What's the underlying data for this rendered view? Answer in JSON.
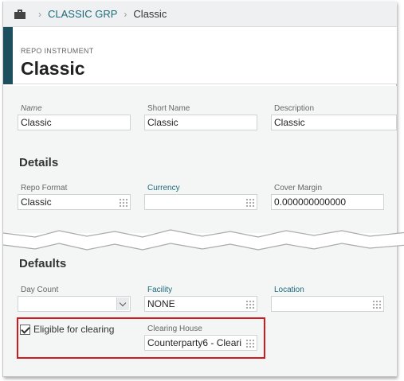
{
  "breadcrumb": {
    "home_icon": "briefcase-icon",
    "separator": "›",
    "group": "CLASSIC GRP",
    "current": "Classic"
  },
  "header": {
    "label": "REPO INSTRUMENT",
    "title": "Classic"
  },
  "general": {
    "name": {
      "label": "Name",
      "value": "Classic"
    },
    "short_name": {
      "label": "Short Name",
      "value": "Classic"
    },
    "description": {
      "label": "Description",
      "value": "Classic"
    }
  },
  "details": {
    "title": "Details",
    "repo_format": {
      "label": "Repo Format",
      "value": "Classic"
    },
    "currency": {
      "label": "Currency",
      "value": ""
    },
    "cover_margin": {
      "label": "Cover Margin",
      "value": "0.000000000000"
    }
  },
  "defaults": {
    "title": "Defaults",
    "day_count": {
      "label": "Day Count",
      "value": ""
    },
    "facility": {
      "label": "Facility",
      "value": "NONE"
    },
    "location": {
      "label": "Location",
      "value": ""
    },
    "eligible_for_clearing": {
      "label": "Eligible for clearing",
      "checked": true
    },
    "clearing_house": {
      "label": "Clearing House",
      "value": "Counterparty6 - Cleari"
    }
  },
  "colors": {
    "accent": "#1d4f5e",
    "link": "#1b6a7a",
    "highlight": "#d2191e"
  }
}
